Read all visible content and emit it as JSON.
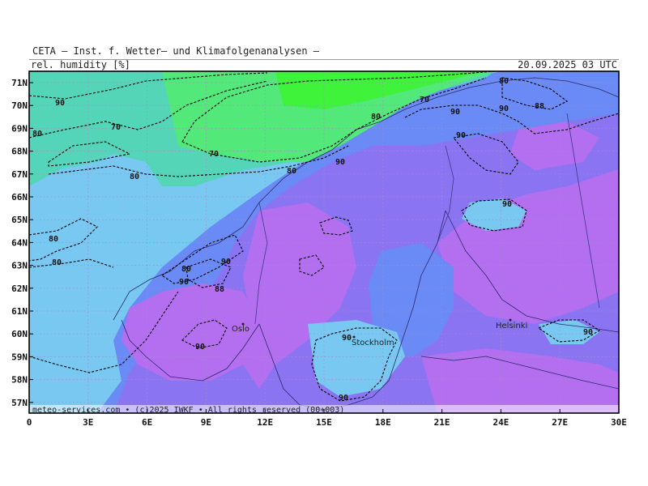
{
  "header": {
    "source": "CETA — Inst. f. Wetter— und Klimafolgenanalysen —",
    "variable": "rel. humidity [%]",
    "datetime": "20.09.2025 03 UTC"
  },
  "footer": {
    "copyright": "meteo-services.com • (c)2025 IWKF • All rights reserved (00+003)"
  },
  "axes": {
    "lat_labels": [
      "71N",
      "70N",
      "69N",
      "68N",
      "67N",
      "66N",
      "65N",
      "64N",
      "63N",
      "62N",
      "61N",
      "60N",
      "59N",
      "58N",
      "57N"
    ],
    "lon_labels": [
      "0",
      "3E",
      "6E",
      "9E",
      "12E",
      "15E",
      "18E",
      "21E",
      "24E",
      "27E",
      "30E"
    ]
  },
  "cities": [
    "Oslo",
    "Stockholm",
    "Helsinki"
  ],
  "contour_labels": {
    "l90a": "90",
    "l80a": "80",
    "l70a": "70",
    "l70b": "70",
    "l80b": "80",
    "l80c": "80",
    "l80d": "80",
    "l80e": "80",
    "l90b": "90",
    "l88": "88",
    "l90c": "90",
    "l80f": "80",
    "l80g": "80",
    "l90d": "90",
    "l70c": "70",
    "l90e": "90",
    "l90f": "90",
    "l90g": "90",
    "l88b": "88",
    "l90h": "90",
    "l90i": "90",
    "l90j": "90",
    "l90k": "90",
    "l90l": "90",
    "l90m": "90"
  },
  "colors": {
    "green": "#3ff23a",
    "green_light": "#52e87a",
    "teal": "#55d5b8",
    "light_blue": "#78c8f2",
    "blue": "#6a8af5",
    "purple_blue": "#8a74f2",
    "violet": "#b46ef0",
    "border": "#000000"
  }
}
